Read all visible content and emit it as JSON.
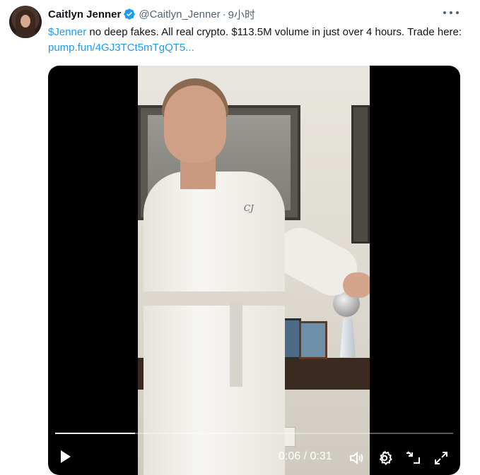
{
  "tweet": {
    "author_name": "Caitlyn Jenner",
    "handle": "@Caitlyn_Jenner",
    "separator": "·",
    "time": "9小时",
    "text_cashtag": "$Jenner",
    "text_body": " no deep fakes. All real crypto. $113.5M volume in just over 4 hours. Trade here: ",
    "text_link": "pump.fun/4GJ3TCt5mTgQT5..."
  },
  "video": {
    "monogram": "CJ",
    "time_current": "0:06",
    "time_separator": " / ",
    "time_total": "0:31",
    "progress": 0.2
  },
  "icons": {
    "verified": "verified-badge-icon",
    "more": "more-options-icon",
    "play": "play-icon",
    "volume": "volume-icon",
    "settings": "settings-gear-icon",
    "minimize": "minimize-icon",
    "fullscreen": "fullscreen-icon"
  },
  "colors": {
    "link": "#1d9bf0",
    "verified": "#1d9bf0",
    "muted_text": "#536471"
  }
}
